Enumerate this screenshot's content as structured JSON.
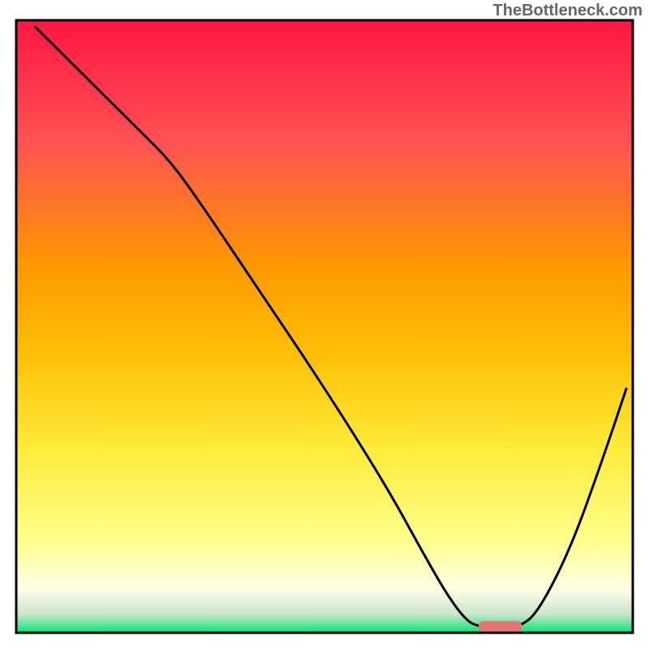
{
  "watermark": "TheBottleneck.com",
  "chart_data": {
    "type": "line",
    "title": "",
    "xlabel": "",
    "ylabel": "",
    "xlim": [
      0,
      100
    ],
    "ylim": [
      0,
      100
    ],
    "background_gradient_stops": [
      {
        "offset": 0,
        "color": "#ff1744"
      },
      {
        "offset": 20,
        "color": "#ff5252"
      },
      {
        "offset": 40,
        "color": "#ff9800"
      },
      {
        "offset": 55,
        "color": "#ffc107"
      },
      {
        "offset": 70,
        "color": "#ffeb3b"
      },
      {
        "offset": 85,
        "color": "#ffff8d"
      },
      {
        "offset": 93,
        "color": "#fffde7"
      },
      {
        "offset": 97,
        "color": "#c8e6c9"
      },
      {
        "offset": 100,
        "color": "#00e676"
      }
    ],
    "curve_points": [
      {
        "x": 3,
        "y": 99
      },
      {
        "x": 10,
        "y": 92
      },
      {
        "x": 20,
        "y": 82
      },
      {
        "x": 25,
        "y": 77
      },
      {
        "x": 30,
        "y": 70
      },
      {
        "x": 40,
        "y": 55
      },
      {
        "x": 50,
        "y": 40
      },
      {
        "x": 60,
        "y": 24
      },
      {
        "x": 66,
        "y": 13
      },
      {
        "x": 70,
        "y": 6
      },
      {
        "x": 73,
        "y": 2
      },
      {
        "x": 75,
        "y": 1
      },
      {
        "x": 78,
        "y": 1
      },
      {
        "x": 82,
        "y": 1
      },
      {
        "x": 85,
        "y": 4
      },
      {
        "x": 90,
        "y": 14
      },
      {
        "x": 95,
        "y": 28
      },
      {
        "x": 99,
        "y": 40
      }
    ],
    "marker": {
      "x_start": 75,
      "x_end": 82,
      "y": 1,
      "color": "#e57373"
    },
    "frame": {
      "color": "#000000",
      "width": 3
    }
  }
}
